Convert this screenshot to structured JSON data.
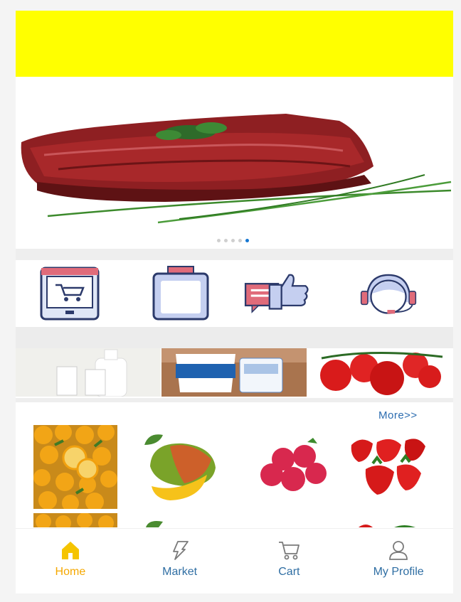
{
  "carousel": {
    "slide_count": 5,
    "active_index": 4
  },
  "categories": [
    {
      "icon": "online-shop-icon"
    },
    {
      "icon": "jar-icon"
    },
    {
      "icon": "thumbs-up-feedback-icon"
    },
    {
      "icon": "customer-service-icon"
    }
  ],
  "promos": [
    {
      "icon": "milk-bottles-image"
    },
    {
      "icon": "yogurt-tubs-image"
    },
    {
      "icon": "tomatoes-image"
    }
  ],
  "products": {
    "more_label": "More>>",
    "items": [
      {
        "icon": "oranges-image"
      },
      {
        "icon": "mango-image"
      },
      {
        "icon": "raspberries-image"
      },
      {
        "icon": "strawberries-image"
      }
    ]
  },
  "tabbar": {
    "tabs": [
      {
        "label": "Home",
        "icon": "home-icon",
        "active": true
      },
      {
        "label": "Market",
        "icon": "market-icon",
        "active": false
      },
      {
        "label": "Cart",
        "icon": "cart-icon",
        "active": false
      },
      {
        "label": "My Profile",
        "icon": "profile-icon",
        "active": false
      }
    ],
    "active_color": "#f5a800",
    "inactive_color": "#2f6ea3"
  },
  "colors": {
    "banner": "#ffff00",
    "dot_active": "#1677d2"
  }
}
